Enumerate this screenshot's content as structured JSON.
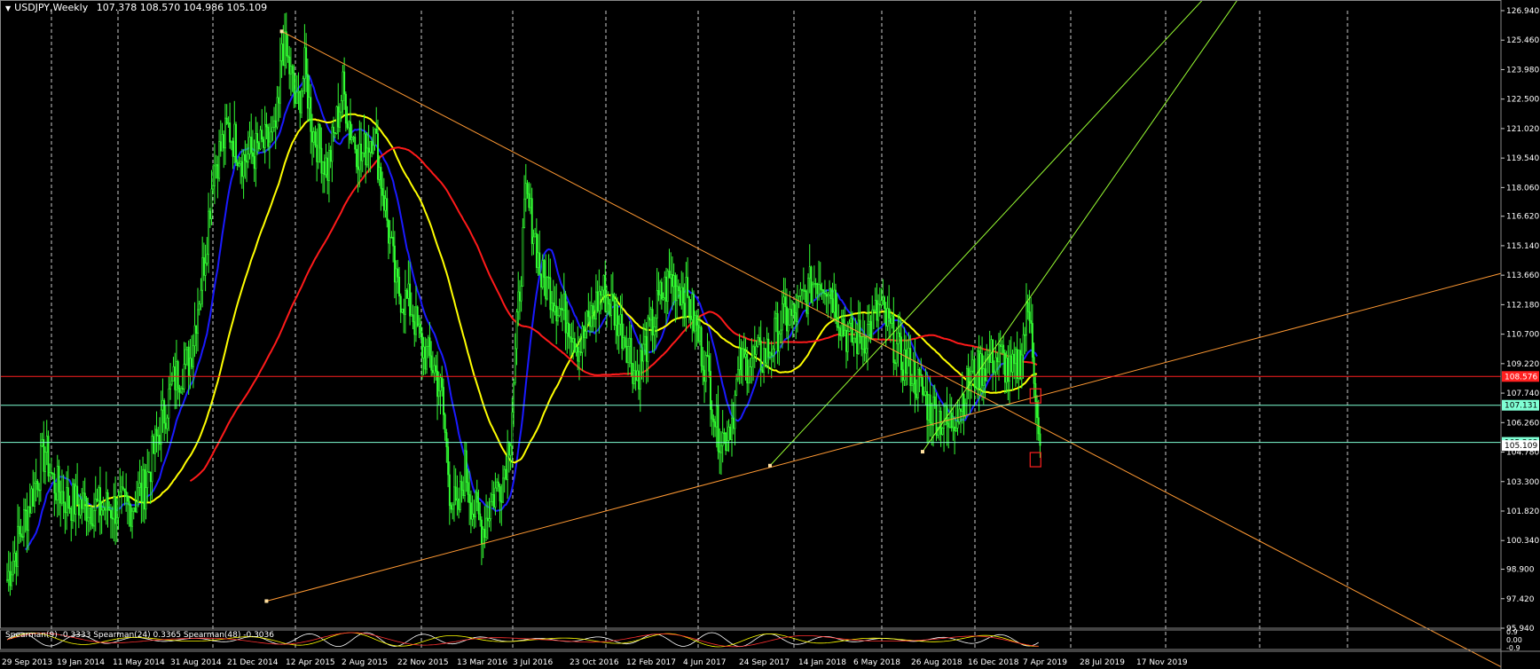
{
  "window": {
    "symbol_label": "USDJPY,Weekly",
    "ohlc": "107.378 108.570 104.986 105.109"
  },
  "indicator": {
    "label": "Spearman(9) -0.3333  Spearman(24) 0.3365  Spearman(48) -0.3036",
    "ticks": [
      "0.9",
      "0.00",
      "-0.9"
    ]
  },
  "colors": {
    "background": "#000000",
    "candle": "#33ff33",
    "ma_fast": "#1a1aff",
    "ma_mid": "#ffff00",
    "ma_slow": "#ff1a1a",
    "trend": "#ff9933",
    "channel": "#99ff33",
    "hline_red": "#ff2020",
    "hline_cyan": "#7fffd4",
    "grid": "#ffffff"
  },
  "chart_data": {
    "type": "candlestick",
    "ylim": [
      95.94,
      126.94
    ],
    "y_ticks": [
      "126.940",
      "125.460",
      "123.980",
      "122.500",
      "121.020",
      "119.540",
      "118.060",
      "116.620",
      "115.140",
      "113.660",
      "112.180",
      "110.700",
      "109.220",
      "107.740",
      "106.260",
      "104.780",
      "103.300",
      "101.820",
      "100.340",
      "98.900",
      "97.420",
      "95.940"
    ],
    "x_labels": [
      "29 Sep 2013",
      "19 Jan 2014",
      "11 May 2014",
      "31 Aug 2014",
      "21 Dec 2014",
      "12 Apr 2015",
      "2 Aug 2015",
      "22 Nov 2015",
      "13 Mar 2016",
      "3 Jul 2016",
      "23 Oct 2016",
      "12 Feb 2017",
      "4 Jun 2017",
      "24 Sep 2017",
      "14 Jan 2018",
      "6 May 2018",
      "26 Aug 2018",
      "16 Dec 2018",
      "7 Apr 2019",
      "28 Jul 2019",
      "17 Nov 2019"
    ],
    "price_keypoints": [
      [
        0,
        98.4
      ],
      [
        10,
        101.0
      ],
      [
        25,
        104.9
      ],
      [
        30,
        103.3
      ],
      [
        40,
        102.3
      ],
      [
        60,
        102.0
      ],
      [
        80,
        102.0
      ],
      [
        90,
        103.0
      ],
      [
        100,
        106.0
      ],
      [
        110,
        108.5
      ],
      [
        120,
        109.5
      ],
      [
        130,
        115.0
      ],
      [
        135,
        119.0
      ],
      [
        145,
        121.0
      ],
      [
        155,
        119.5
      ],
      [
        165,
        120.0
      ],
      [
        175,
        120.5
      ],
      [
        178,
        122.0
      ],
      [
        180,
        125.4
      ],
      [
        185,
        124.0
      ],
      [
        190,
        122.0
      ],
      [
        195,
        124.0
      ],
      [
        200,
        121.0
      ],
      [
        205,
        120.0
      ],
      [
        210,
        119.0
      ],
      [
        220,
        123.0
      ],
      [
        225,
        121.0
      ],
      [
        232,
        119.5
      ],
      [
        240,
        121.0
      ],
      [
        248,
        117.0
      ],
      [
        255,
        113.0
      ],
      [
        265,
        112.0
      ],
      [
        272,
        110.0
      ],
      [
        280,
        109.0
      ],
      [
        285,
        107.5
      ],
      [
        290,
        103.0
      ],
      [
        295,
        101.5
      ],
      [
        300,
        104.0
      ],
      [
        305,
        102.0
      ],
      [
        312,
        101.0
      ],
      [
        318,
        102.5
      ],
      [
        325,
        103.5
      ],
      [
        330,
        106.0
      ],
      [
        335,
        112.0
      ],
      [
        340,
        117.5
      ],
      [
        345,
        116.0
      ],
      [
        350,
        113.5
      ],
      [
        356,
        113.0
      ],
      [
        362,
        112.0
      ],
      [
        368,
        111.5
      ],
      [
        375,
        110.0
      ],
      [
        385,
        112.0
      ],
      [
        390,
        113.0
      ],
      [
        400,
        111.5
      ],
      [
        408,
        110.0
      ],
      [
        412,
        108.5
      ],
      [
        420,
        110.5
      ],
      [
        428,
        112.5
      ],
      [
        435,
        113.5
      ],
      [
        442,
        113.0
      ],
      [
        448,
        112.0
      ],
      [
        455,
        110.0
      ],
      [
        460,
        108.5
      ],
      [
        465,
        106.0
      ],
      [
        470,
        105.5
      ],
      [
        475,
        106.5
      ],
      [
        480,
        109.0
      ],
      [
        488,
        109.5
      ],
      [
        495,
        109.5
      ],
      [
        500,
        110.0
      ],
      [
        508,
        111.5
      ],
      [
        515,
        111.5
      ],
      [
        522,
        112.5
      ],
      [
        530,
        113.5
      ],
      [
        536,
        113.5
      ],
      [
        542,
        112.5
      ],
      [
        548,
        111.0
      ],
      [
        552,
        110.5
      ],
      [
        560,
        110.5
      ],
      [
        565,
        111.0
      ],
      [
        572,
        112.0
      ],
      [
        578,
        111.0
      ],
      [
        585,
        109.5
      ],
      [
        592,
        109.0
      ],
      [
        598,
        108.0
      ],
      [
        605,
        107.0
      ],
      [
        612,
        106.5
      ],
      [
        617,
        106.0
      ],
      [
        620,
        106.5
      ],
      [
        626,
        107.5
      ],
      [
        632,
        108.5
      ],
      [
        638,
        109.0
      ],
      [
        645,
        109.5
      ],
      [
        652,
        109.5
      ],
      [
        658,
        108.5
      ],
      [
        664,
        109.5
      ],
      [
        668,
        111.5
      ],
      [
        671,
        112.0
      ],
      [
        674,
        107.0
      ],
      [
        676,
        105.1
      ]
    ],
    "trendlines": [
      {
        "name": "upper-trend",
        "points": [
          [
            180,
            125.9
          ],
          [
            711,
            104.7
          ]
        ]
      },
      {
        "name": "lower-trend",
        "points": [
          [
            170,
            97.3
          ],
          [
            711,
            108.3
          ]
        ]
      },
      {
        "name": "channel-upper",
        "points": [
          [
            500,
            104.1
          ],
          [
            711,
            121.5
          ]
        ]
      },
      {
        "name": "channel-lower",
        "points": [
          [
            600,
            104.8
          ],
          [
            711,
            117.0
          ]
        ]
      }
    ],
    "hlines": [
      {
        "value": 108.576,
        "label": "108.576",
        "color": "red"
      },
      {
        "value": 107.131,
        "label": "107.131",
        "color": "cyan"
      },
      {
        "value": 105.268,
        "label": "105.268",
        "color": "cyan"
      },
      {
        "value": 105.109,
        "label": "105.109",
        "color": "white"
      }
    ]
  }
}
